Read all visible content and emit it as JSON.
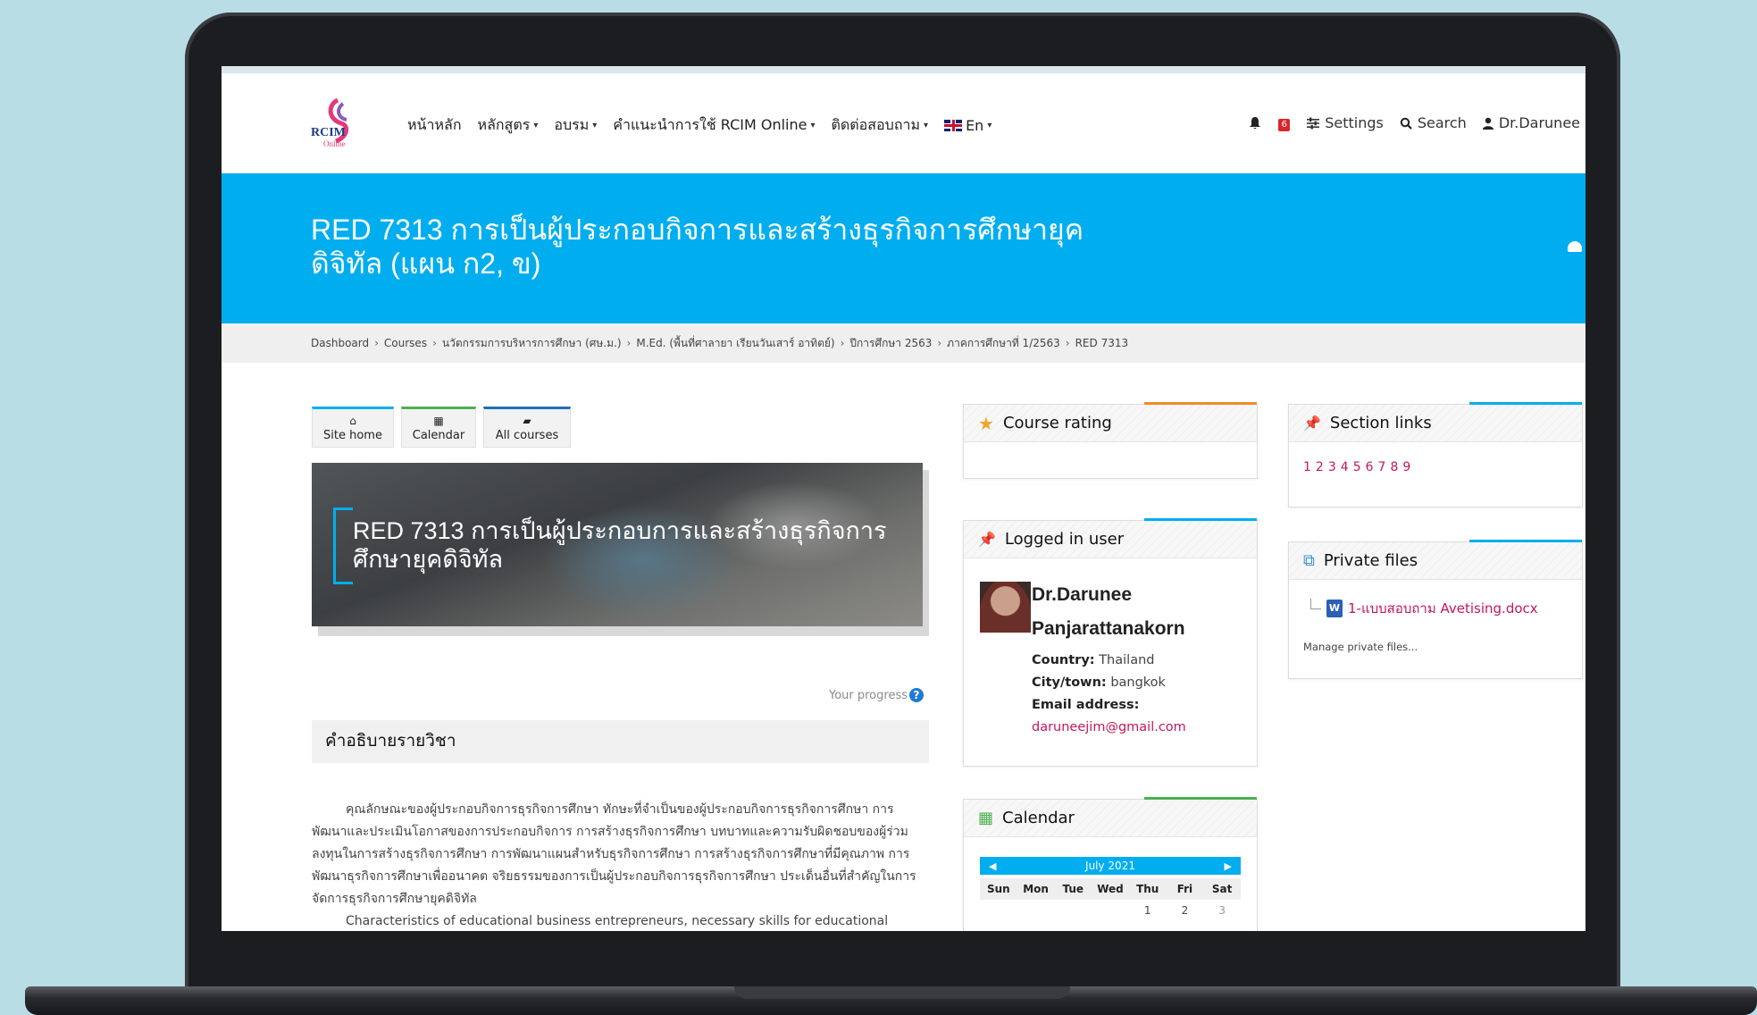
{
  "nav": {
    "menu": [
      {
        "label": "หน้าหลัก",
        "caret": false
      },
      {
        "label": "หลักสูตร",
        "caret": true
      },
      {
        "label": "อบรม",
        "caret": true
      },
      {
        "label": "คำแนะนำการใช้ RCIM Online",
        "caret": true
      },
      {
        "label": "ติดต่อสอบถาม",
        "caret": true
      }
    ],
    "language_label": "En",
    "notification_count": "6",
    "settings_label": "Settings",
    "search_label": "Search",
    "user_label": "Dr.Darunee",
    "logo_text": "RCIM",
    "logo_sub": "Online"
  },
  "header": {
    "course_title": "RED 7313 การเป็นผู้ประกอบกิจการและสร้างธุรกิจการศึกษายุคดิจิทัล (แผน ก2, ข)"
  },
  "breadcrumb": [
    "Dashboard",
    "Courses",
    "นวัตกรรมการบริหารการศึกษา (ศษ.ม.)",
    "M.Ed. (พื้นที่ศาลายา เรียนวันเสาร์ อาทิตย์)",
    "ปีการศึกษา 2563",
    "ภาคการศึกษาที่ 1/2563",
    "RED 7313"
  ],
  "quicklinks": {
    "site_home": "Site home",
    "calendar": "Calendar",
    "all_courses": "All courses"
  },
  "banner": {
    "title": "RED 7313 การเป็นผู้ประกอบการและสร้างธุรกิจการศึกษายุคดิจิทัล"
  },
  "progress_label": "Your progress",
  "section": {
    "heading": "คำอธิบายรายวิชา",
    "desc_th": "คุณลักษณะของผู้ประกอบกิจการธุรกิจการศึกษา ทักษะที่จำเป็นของผู้ประกอบกิจการธุรกิจการศึกษา การพัฒนาและประเมินโอกาสของการประกอบกิจการ การสร้างธุรกิจการศึกษา บทบาทและความรับผิดชอบของผู้ร่วมลงทุนในการสร้างธุรกิจการศึกษา การพัฒนาแผนสำหรับธุรกิจการศึกษา การสร้างธุรกิจการศึกษาที่มีคุณภาพ การพัฒนาธุรกิจการศึกษาเพื่ออนาคต จริยธรรมของการเป็นผู้ประกอบกิจการธุรกิจการศึกษา ประเด็นอื่นที่สำคัญในการจัดการธุรกิจการศึกษายุคดิจิทัล",
    "desc_en": "Characteristics of educational business entrepreneurs, necessary skills for educational"
  },
  "blocks": {
    "rating_title": "Course rating",
    "logged_title": "Logged in user",
    "user": {
      "first": "Dr.Darunee",
      "last": "Panjarattanakorn",
      "country_label": "Country:",
      "country": "Thailand",
      "city_label": "City/town:",
      "city": "bangkok",
      "email_label": "Email address:",
      "email": "daruneejim@gmail.com"
    },
    "calendar_title": "Calendar",
    "calendar": {
      "month": "July 2021",
      "days": [
        "Sun",
        "Mon",
        "Tue",
        "Wed",
        "Thu",
        "Fri",
        "Sat"
      ],
      "first_row": [
        "",
        "",
        "",
        "",
        "1",
        "2",
        "3"
      ]
    },
    "section_links_title": "Section links",
    "section_links": [
      "1",
      "2",
      "3",
      "4",
      "5",
      "6",
      "7",
      "8",
      "9"
    ],
    "private_files_title": "Private files",
    "file_name": "1-แบบสอบถาม Avetising.docx",
    "manage_files": "Manage private files..."
  },
  "colors": {
    "accent_blue": "#00aeef",
    "link_pink": "#c2185b",
    "rating_orange": "#f0a42a",
    "calendar_green": "#4caf50"
  }
}
